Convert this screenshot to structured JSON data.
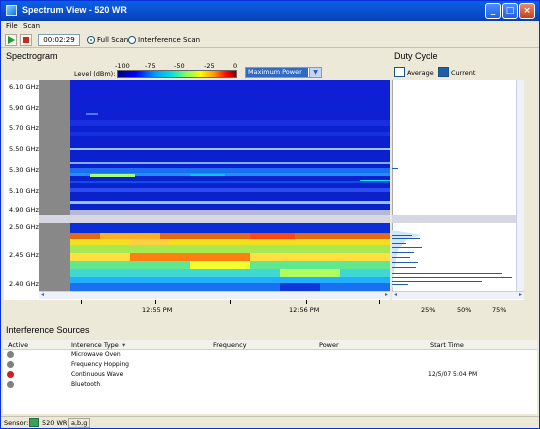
{
  "window": {
    "title": "Spectrum View - 520 WR"
  },
  "menu": [
    "File",
    "Scan"
  ],
  "toolbar": {
    "timer": "00:02:29",
    "full_scan": "Full Scan",
    "interference_scan": "Interference Scan",
    "selected_scan": "Full Scan"
  },
  "spectrogram": {
    "title": "Spectrogram",
    "level_label": "Level (dBm):",
    "level_ticks": [
      "-100",
      "-75",
      "-50",
      "-25",
      "0"
    ],
    "dropdown_value": "Maximum Power",
    "upper_freq_labels": [
      "6.10 GHz",
      "5.90 GHz",
      "5.70 GHz",
      "5.50 GHz",
      "5.30 GHz",
      "5.10 GHz",
      "4.90 GHz"
    ],
    "lower_freq_labels": [
      "2.50 GHz",
      "2.45 GHz",
      "2.40 GHz"
    ],
    "time_labels": [
      "12:55 PM",
      "12:56 PM"
    ]
  },
  "duty_cycle": {
    "title": "Duty Cycle",
    "legend_average": "Average",
    "legend_current": "Current",
    "axis_labels": [
      "25%",
      "50%",
      "75%"
    ]
  },
  "interference": {
    "title": "Interference Sources",
    "columns": [
      "Active",
      "Interence Type",
      "Frequency",
      "Power",
      "Start Time"
    ],
    "rows": [
      {
        "type": "Microwave Oven",
        "start": "",
        "color": "#808080"
      },
      {
        "type": "Frequency Hopping",
        "start": "",
        "color": "#808080"
      },
      {
        "type": "Continuous Wave",
        "start": "12/5/07 5:04 PM",
        "color": "#cc1f1f"
      },
      {
        "type": "Bluetooth",
        "start": "",
        "color": "#808080"
      }
    ]
  },
  "status": {
    "sensor_label": "Sensor:",
    "sensor_name": "520 WR",
    "sensor_extra": "a,b,g"
  }
}
